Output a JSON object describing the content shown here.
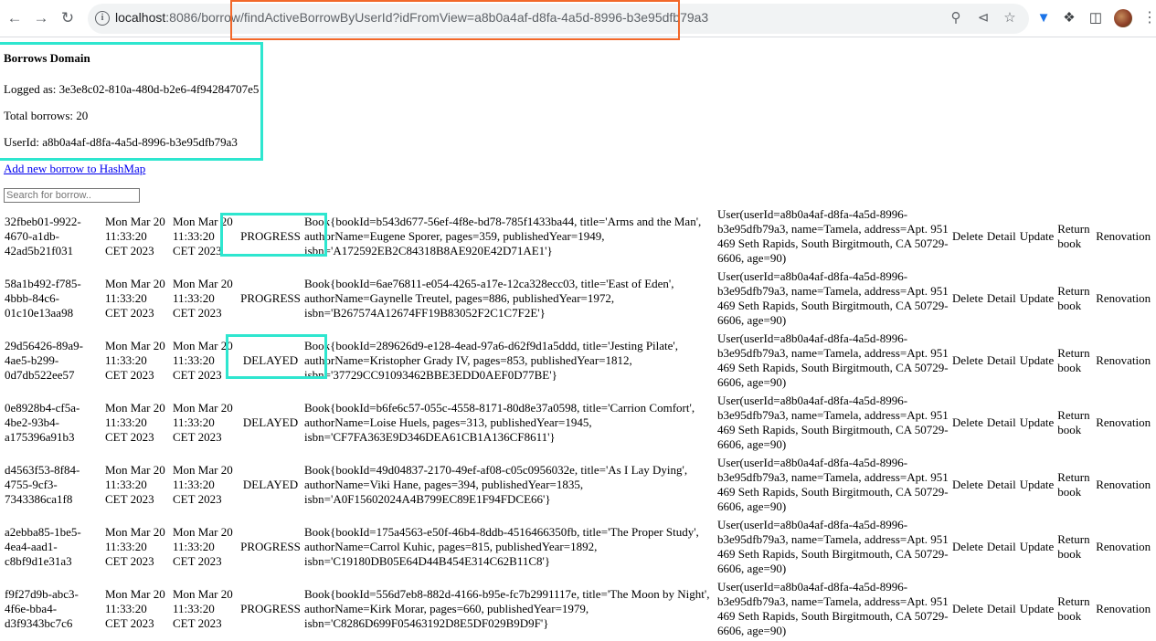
{
  "browser": {
    "url_host": "localhost",
    "url_path": ":8086/borrow/findActiveBorrowByUserId?idFromView=a8b0a4af-d8fa-4a5d-8996-b3e95dfb79a3"
  },
  "page": {
    "title": "Borrows Domain",
    "logged_as": "Logged as: 3e3e8c02-810a-480d-b2e6-4f94284707e5",
    "total_borrows": "Total borrows: 20",
    "user_id": "UserId: a8b0a4af-d8fa-4a5d-8996-b3e95dfb79a3",
    "add_link": "Add new borrow to HashMap",
    "search_placeholder": "Search for borrow.."
  },
  "actions": {
    "delete": "Delete",
    "detail": "Detail",
    "update": "Update",
    "return_book": "Return book",
    "renovation": "Renovation"
  },
  "rows": [
    {
      "id": "32fbeb01-9922-4670-a1db-42ad5b21f031",
      "start": "Mon Mar 20 11:33:20 CET 2023",
      "end": "Mon Mar 20 11:33:20 CET 2023",
      "status": "PROGRESS",
      "book": "Book{bookId=b543d677-56ef-4f8e-bd78-785f1433ba44, title='Arms and the Man', authorName=Eugene Sporer, pages=359, publishedYear=1949, isbn='A172592EB2C84318B8AE920E42D71AE1'}",
      "user": "User(userId=a8b0a4af-d8fa-4a5d-8996-b3e95dfb79a3, name=Tamela, address=Apt. 951 469 Seth Rapids, South Birgitmouth, CA 50729-6606, age=90)"
    },
    {
      "id": "58a1b492-f785-4bbb-84c6-01c10e13aa98",
      "start": "Mon Mar 20 11:33:20 CET 2023",
      "end": "Mon Mar 20 11:33:20 CET 2023",
      "status": "PROGRESS",
      "book": "Book{bookId=6ae76811-e054-4265-a17e-12ca328ecc03, title='East of Eden', authorName=Gaynelle Treutel, pages=886, publishedYear=1972, isbn='B267574A12674FF19B83052F2C1C7F2E'}",
      "user": "User(userId=a8b0a4af-d8fa-4a5d-8996-b3e95dfb79a3, name=Tamela, address=Apt. 951 469 Seth Rapids, South Birgitmouth, CA 50729-6606, age=90)"
    },
    {
      "id": "29d56426-89a9-4ae5-b299-0d7db522ee57",
      "start": "Mon Mar 20 11:33:20 CET 2023",
      "end": "Mon Mar 20 11:33:20 CET 2023",
      "status": "DELAYED",
      "book": "Book{bookId=289626d9-e128-4ead-97a6-d62f9d1a5ddd, title='Jesting Pilate', authorName=Kristopher Grady IV, pages=853, publishedYear=1812, isbn='37729CC91093462BBE3EDD0AEF0D77BE'}",
      "user": "User(userId=a8b0a4af-d8fa-4a5d-8996-b3e95dfb79a3, name=Tamela, address=Apt. 951 469 Seth Rapids, South Birgitmouth, CA 50729-6606, age=90)"
    },
    {
      "id": "0e8928b4-cf5a-4be2-93b4-a175396a91b3",
      "start": "Mon Mar 20 11:33:20 CET 2023",
      "end": "Mon Mar 20 11:33:20 CET 2023",
      "status": "DELAYED",
      "book": "Book{bookId=b6fe6c57-055c-4558-8171-80d8e37a0598, title='Carrion Comfort', authorName=Loise Huels, pages=313, publishedYear=1945, isbn='CF7FA363E9D346DEA61CB1A136CF8611'}",
      "user": "User(userId=a8b0a4af-d8fa-4a5d-8996-b3e95dfb79a3, name=Tamela, address=Apt. 951 469 Seth Rapids, South Birgitmouth, CA 50729-6606, age=90)"
    },
    {
      "id": "d4563f53-8f84-4755-9cf3-7343386ca1f8",
      "start": "Mon Mar 20 11:33:20 CET 2023",
      "end": "Mon Mar 20 11:33:20 CET 2023",
      "status": "DELAYED",
      "book": "Book{bookId=49d04837-2170-49ef-af08-c05c0956032e, title='As I Lay Dying', authorName=Viki Hane, pages=394, publishedYear=1835, isbn='A0F15602024A4B799EC89E1F94FDCE66'}",
      "user": "User(userId=a8b0a4af-d8fa-4a5d-8996-b3e95dfb79a3, name=Tamela, address=Apt. 951 469 Seth Rapids, South Birgitmouth, CA 50729-6606, age=90)"
    },
    {
      "id": "a2ebba85-1be5-4ea4-aad1-c8bf9d1e31a3",
      "start": "Mon Mar 20 11:33:20 CET 2023",
      "end": "Mon Mar 20 11:33:20 CET 2023",
      "status": "PROGRESS",
      "book": "Book{bookId=175a4563-e50f-46b4-8ddb-4516466350fb, title='The Proper Study', authorName=Carrol Kuhic, pages=815, publishedYear=1892, isbn='C19180DB05E64D44B454E314C62B11C8'}",
      "user": "User(userId=a8b0a4af-d8fa-4a5d-8996-b3e95dfb79a3, name=Tamela, address=Apt. 951 469 Seth Rapids, South Birgitmouth, CA 50729-6606, age=90)"
    },
    {
      "id": "f9f27d9b-abc3-4f6e-bba4-d3f9343bc7c6",
      "start": "Mon Mar 20 11:33:20 CET 2023",
      "end": "Mon Mar 20 11:33:20 CET 2023",
      "status": "PROGRESS",
      "book": "Book{bookId=556d7eb8-882d-4166-b95e-fc7b2991117e, title='The Moon by Night', authorName=Kirk Morar, pages=660, publishedYear=1979, isbn='C8286D699F05463192D8E5DF029B9D9F'}",
      "user": "User(userId=a8b0a4af-d8fa-4a5d-8996-b3e95dfb79a3, name=Tamela, address=Apt. 951 469 Seth Rapids, South Birgitmouth, CA 50729-6606, age=90)"
    }
  ]
}
